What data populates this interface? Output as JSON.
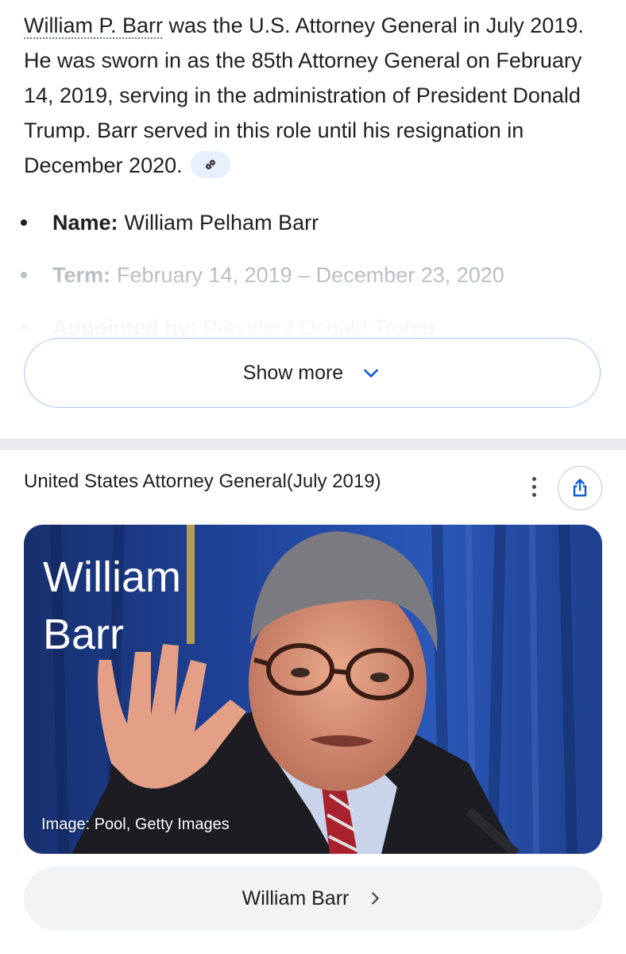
{
  "answer": {
    "link_text": "William P. Barr",
    "text": " was the U.S. Attorney General in July 2019. He was sworn in as the 85th Attorney General on February 14, 2019, serving in the administration of President Donald Trump. Barr served in this role until his resignation in December 2020.",
    "citation_icon": "link-icon"
  },
  "facts": [
    {
      "label": "Name:",
      "value": "William Pelham Barr"
    },
    {
      "label": "Term:",
      "value": "February 14, 2019 – December 23, 2020"
    },
    {
      "label": "Appointed by:",
      "value": "President Donald Trump"
    }
  ],
  "show_more": {
    "label": "Show more",
    "icon": "chevron-down-icon"
  },
  "card": {
    "title": "United States Attorney General(July 2019)",
    "menu_icon": "more-vert-icon",
    "share_icon": "share-icon",
    "image": {
      "name_line1": "William",
      "name_line2": "Barr",
      "credit": "Image: Pool, Getty Images"
    },
    "entity_button": {
      "label": "William Barr",
      "icon": "chevron-right-icon"
    }
  },
  "colors": {
    "accent": "#0b57d0",
    "chip_bg": "#e8effd",
    "button_border": "#a8c7fa",
    "divider": "#e8eaed"
  }
}
